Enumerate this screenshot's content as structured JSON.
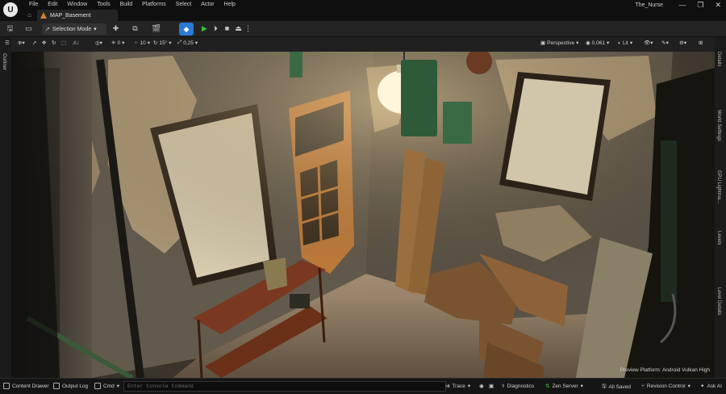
{
  "menu": [
    "File",
    "Edit",
    "Window",
    "Tools",
    "Build",
    "Platforms",
    "Select",
    "Actor",
    "Help"
  ],
  "tab": {
    "level_name": "MAP_Basement"
  },
  "project": {
    "name": "The_Nurse"
  },
  "window_controls": [
    "—",
    "❐",
    "✕"
  ],
  "toolbar": {
    "selection_mode": "Selection Mode"
  },
  "viewport_toolbar": {
    "snap_translate": "0",
    "snap_rotate": "10",
    "snap_angle": "15°",
    "snap_scale": "0,25",
    "perspective": "Perspective",
    "fov": "0,061",
    "view_mode": "Lit"
  },
  "left_panel": {
    "outliner": "Outliner"
  },
  "right_panel": {
    "details": "Details",
    "world_settings": "World Settings",
    "gpu_lightmass": "GPU Lightma...",
    "levels": "Levels",
    "level_details": "Level Details"
  },
  "viewport": {
    "preview_platform": "Preview Platform:  Android Vulkan High"
  },
  "statusbar": {
    "content_drawer": "Content Drawer",
    "output_log": "Output Log",
    "cmd": "Cmd",
    "console_placeholder": "Enter Console Command",
    "trace": "Trace",
    "diagnostics": "Diagnostics",
    "zen_server": "Zen Server",
    "all_saved": "All Saved",
    "revision_control": "Revision Control",
    "ask_ai": "Ask AI"
  }
}
